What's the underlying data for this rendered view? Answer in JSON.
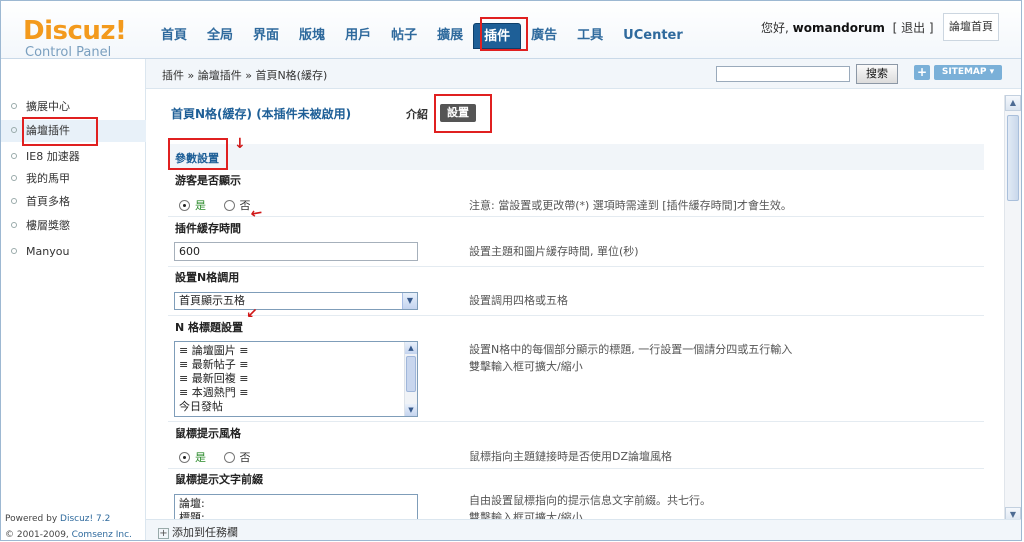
{
  "logo": {
    "main": "Discuz!",
    "sub": "Control Panel"
  },
  "nav": [
    {
      "label": "首頁"
    },
    {
      "label": "全局"
    },
    {
      "label": "界面"
    },
    {
      "label": "版塊"
    },
    {
      "label": "用戶"
    },
    {
      "label": "帖子"
    },
    {
      "label": "擴展"
    },
    {
      "label": "插件",
      "active": true
    },
    {
      "label": "廣告"
    },
    {
      "label": "工具"
    },
    {
      "label": "UCenter"
    }
  ],
  "user": {
    "greeting": "您好,",
    "name": "womandorum",
    "logout": "[ 退出 ]",
    "home": "論壇首頁"
  },
  "subbar": {
    "breadcrumb": "插件 » 論壇插件 » 首頁N格(緩存)",
    "search_button": "搜索",
    "plus": "+",
    "sitemap": "SITEMAP ▾"
  },
  "sidebar": {
    "items": [
      {
        "label": "擴展中心"
      },
      {
        "label": "論壇插件",
        "active": true
      },
      {
        "label": "IE8 加速器"
      },
      {
        "label": "我的馬甲"
      },
      {
        "label": "首頁多格"
      },
      {
        "label": "樓層獎懲"
      },
      {
        "label": "Manyou"
      }
    ],
    "powered_prefix": "Powered by ",
    "powered_link": "Discuz! 7.2",
    "copyright_prefix": "© 2001-2009, ",
    "copyright_link": "Comsenz Inc."
  },
  "content": {
    "title": "首頁N格(緩存) (本插件未被啟用)",
    "tab_intro": "介紹",
    "tab_settings": "設置",
    "section_title": "參數設置",
    "rows": {
      "guest": {
        "label": "游客是否顯示",
        "yes": "是",
        "no": "否",
        "note": "注意: 當設置或更改帶(*) 選項時需達到 [插件緩存時間]才會生效。"
      },
      "cache": {
        "label": "插件緩存時間",
        "value": "600",
        "note": "設置主題和圖片緩存時間, 單位(秒)"
      },
      "ngrid": {
        "label": "設置N格調用",
        "value": "首頁顯示五格",
        "note": "設置調用四格或五格"
      },
      "titles": {
        "label": "N 格標題設置",
        "lines": [
          "≡ 論壇圖片 ≡",
          "≡ 最新帖子 ≡",
          "≡ 最新回複 ≡",
          "≡ 本週熱門 ≡",
          "今日發帖"
        ],
        "note_line1": "設置N格中的每個部分顯示的標題, 一行設置一個請分四或五行輸入",
        "note_line2": "雙擊輸入框可擴大/縮小"
      },
      "tipstyle": {
        "label": "鼠標提示風格",
        "yes": "是",
        "no": "否",
        "note": "鼠標指向主題鏈接時是否使用DZ論壇風格"
      },
      "tipprefix": {
        "label": "鼠標提示文字前綴",
        "lines": [
          "論壇:",
          "標題:"
        ],
        "note_line1": "自由設置鼠標指向的提示信息文字前綴。共七行。",
        "note_line2": "雙擊輸入框可擴大/縮小"
      }
    }
  },
  "bottombar": {
    "add_task": "添加到任務欄"
  },
  "colors": {
    "accent": "#1e5f97",
    "logo_orange": "#f39a1d",
    "highlight_red": "#e02020"
  }
}
